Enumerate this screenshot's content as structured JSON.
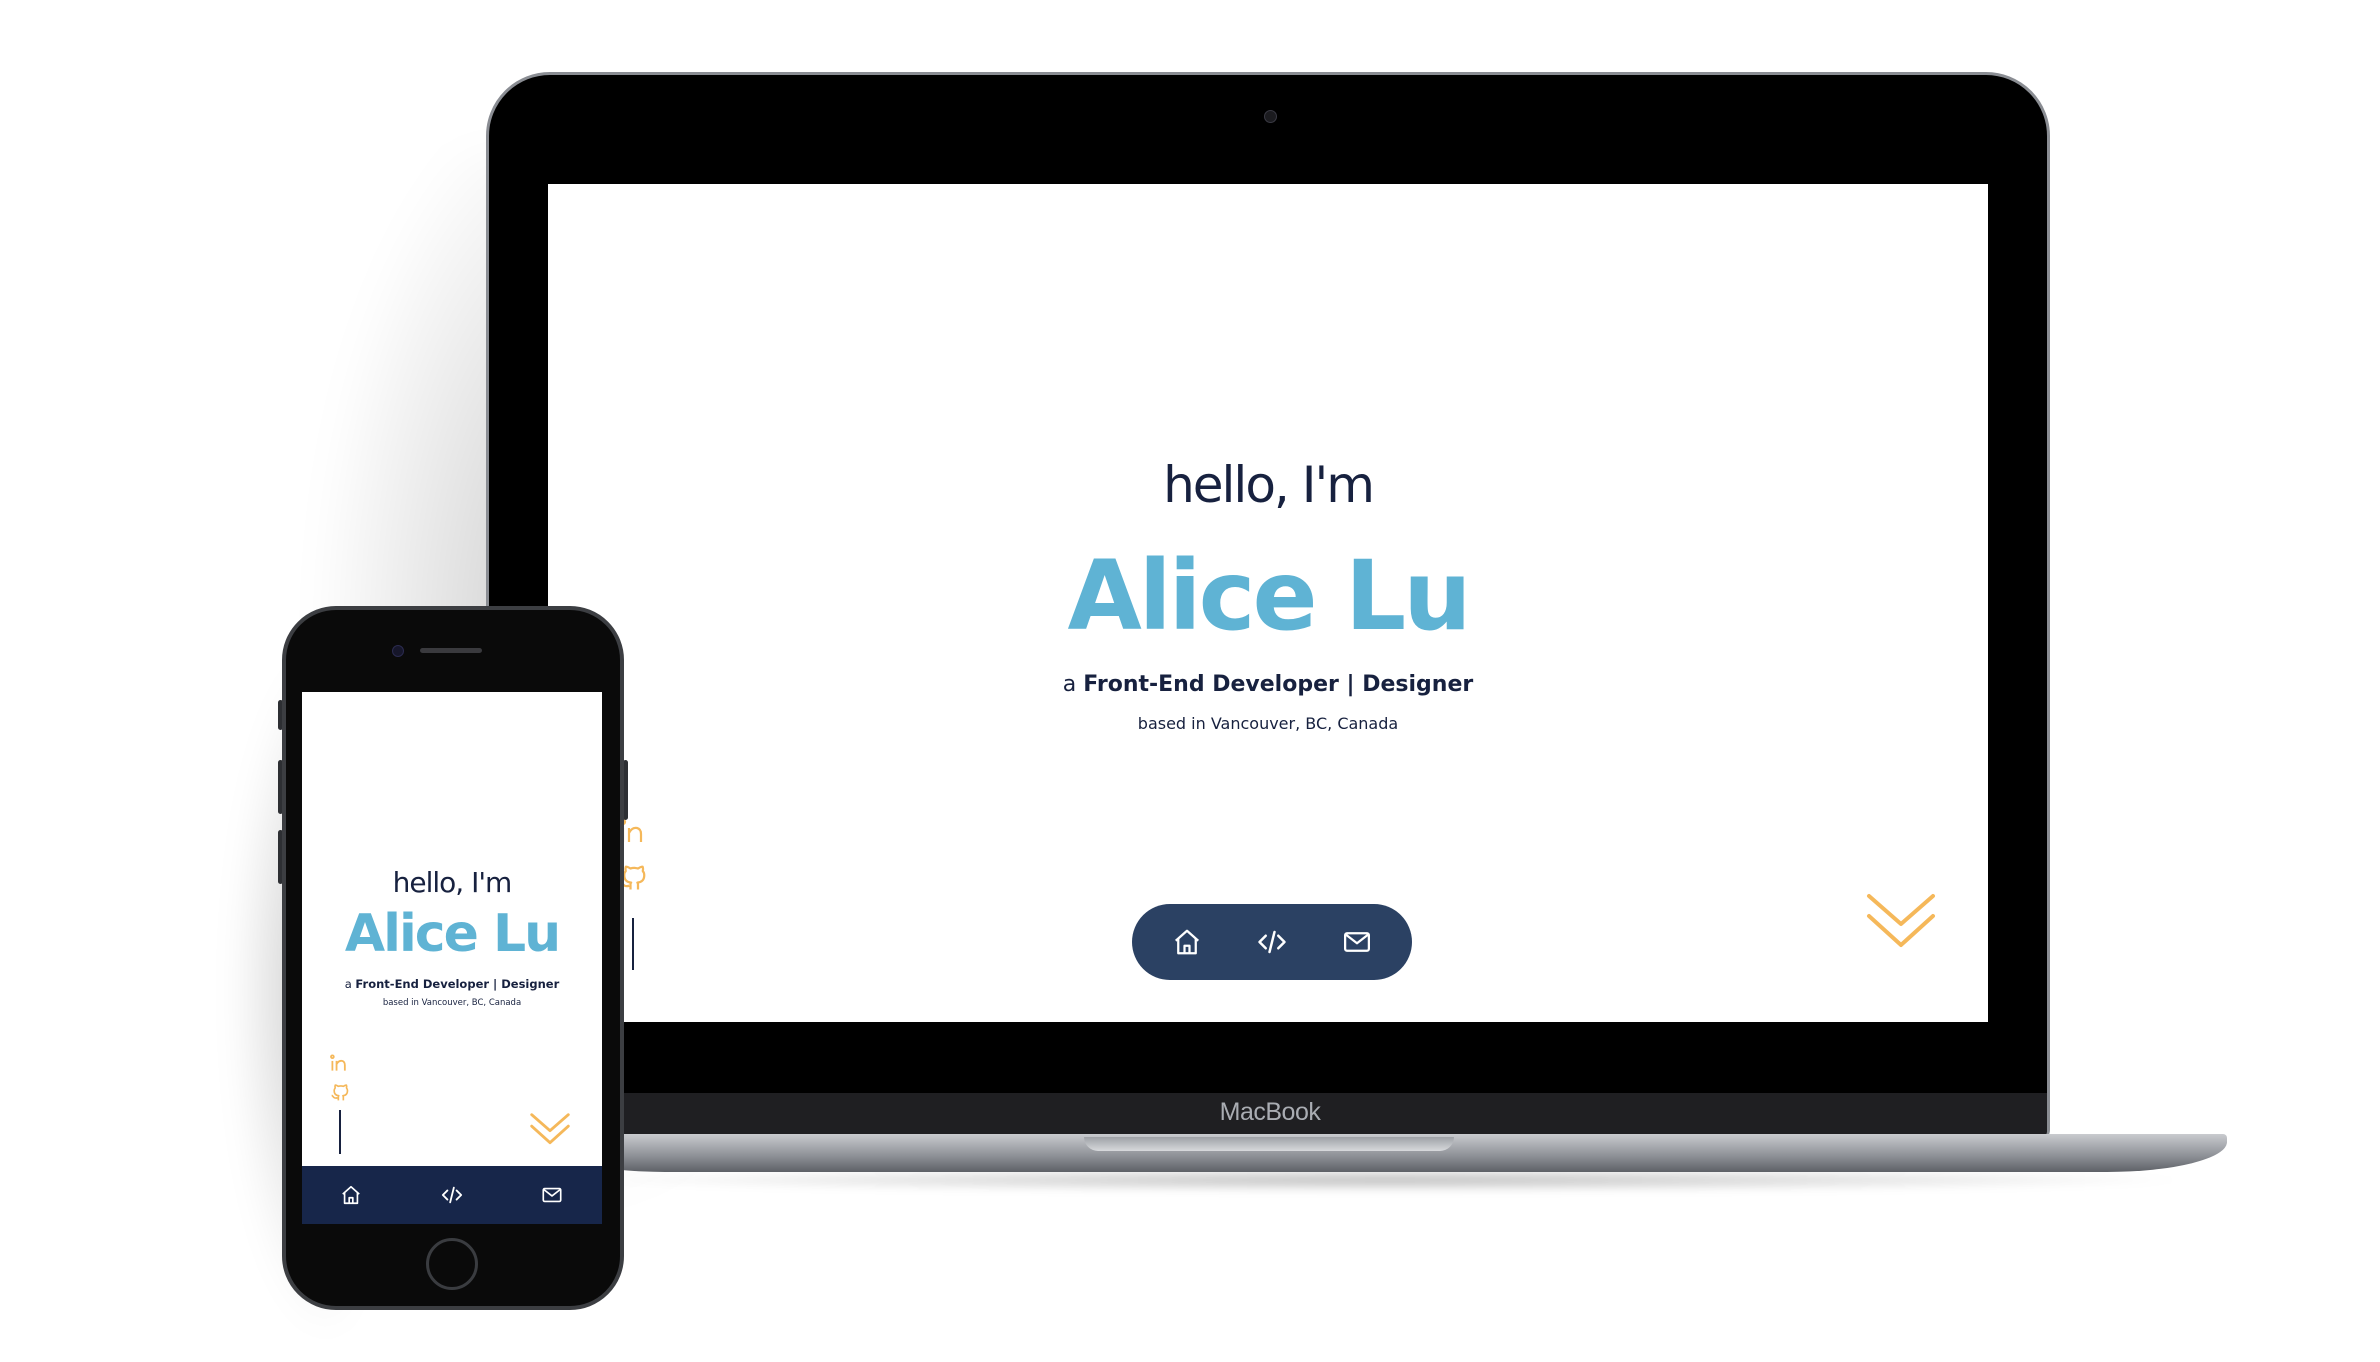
{
  "laptop": {
    "brand_label": "MacBook",
    "hero": {
      "greeting": "hello, I'm",
      "name": "Alice Lu",
      "role_prefix": "a ",
      "role": "Front-End Developer | Designer",
      "location": "based in Vancouver, BC, Canada"
    },
    "nav": {
      "items": [
        {
          "icon": "home-icon"
        },
        {
          "icon": "code-icon"
        },
        {
          "icon": "mail-icon"
        }
      ]
    },
    "scroll_icon": "double-chevron-down-icon"
  },
  "phone": {
    "hero": {
      "greeting": "hello, I'm",
      "name": "Alice Lu",
      "role_prefix": "a ",
      "role": "Front-End Developer | Designer",
      "location": "based in Vancouver, BC, Canada"
    },
    "social": [
      {
        "icon": "linkedin-icon"
      },
      {
        "icon": "github-icon"
      }
    ],
    "nav": {
      "items": [
        {
          "icon": "home-icon"
        },
        {
          "icon": "code-icon"
        },
        {
          "icon": "mail-icon"
        }
      ]
    }
  },
  "colors": {
    "navy": "#17213f",
    "accent_blue": "#5fb3d4",
    "accent_orange": "#f5b85a",
    "nav_pill": "#2b4163",
    "phone_nav": "#17264a"
  }
}
